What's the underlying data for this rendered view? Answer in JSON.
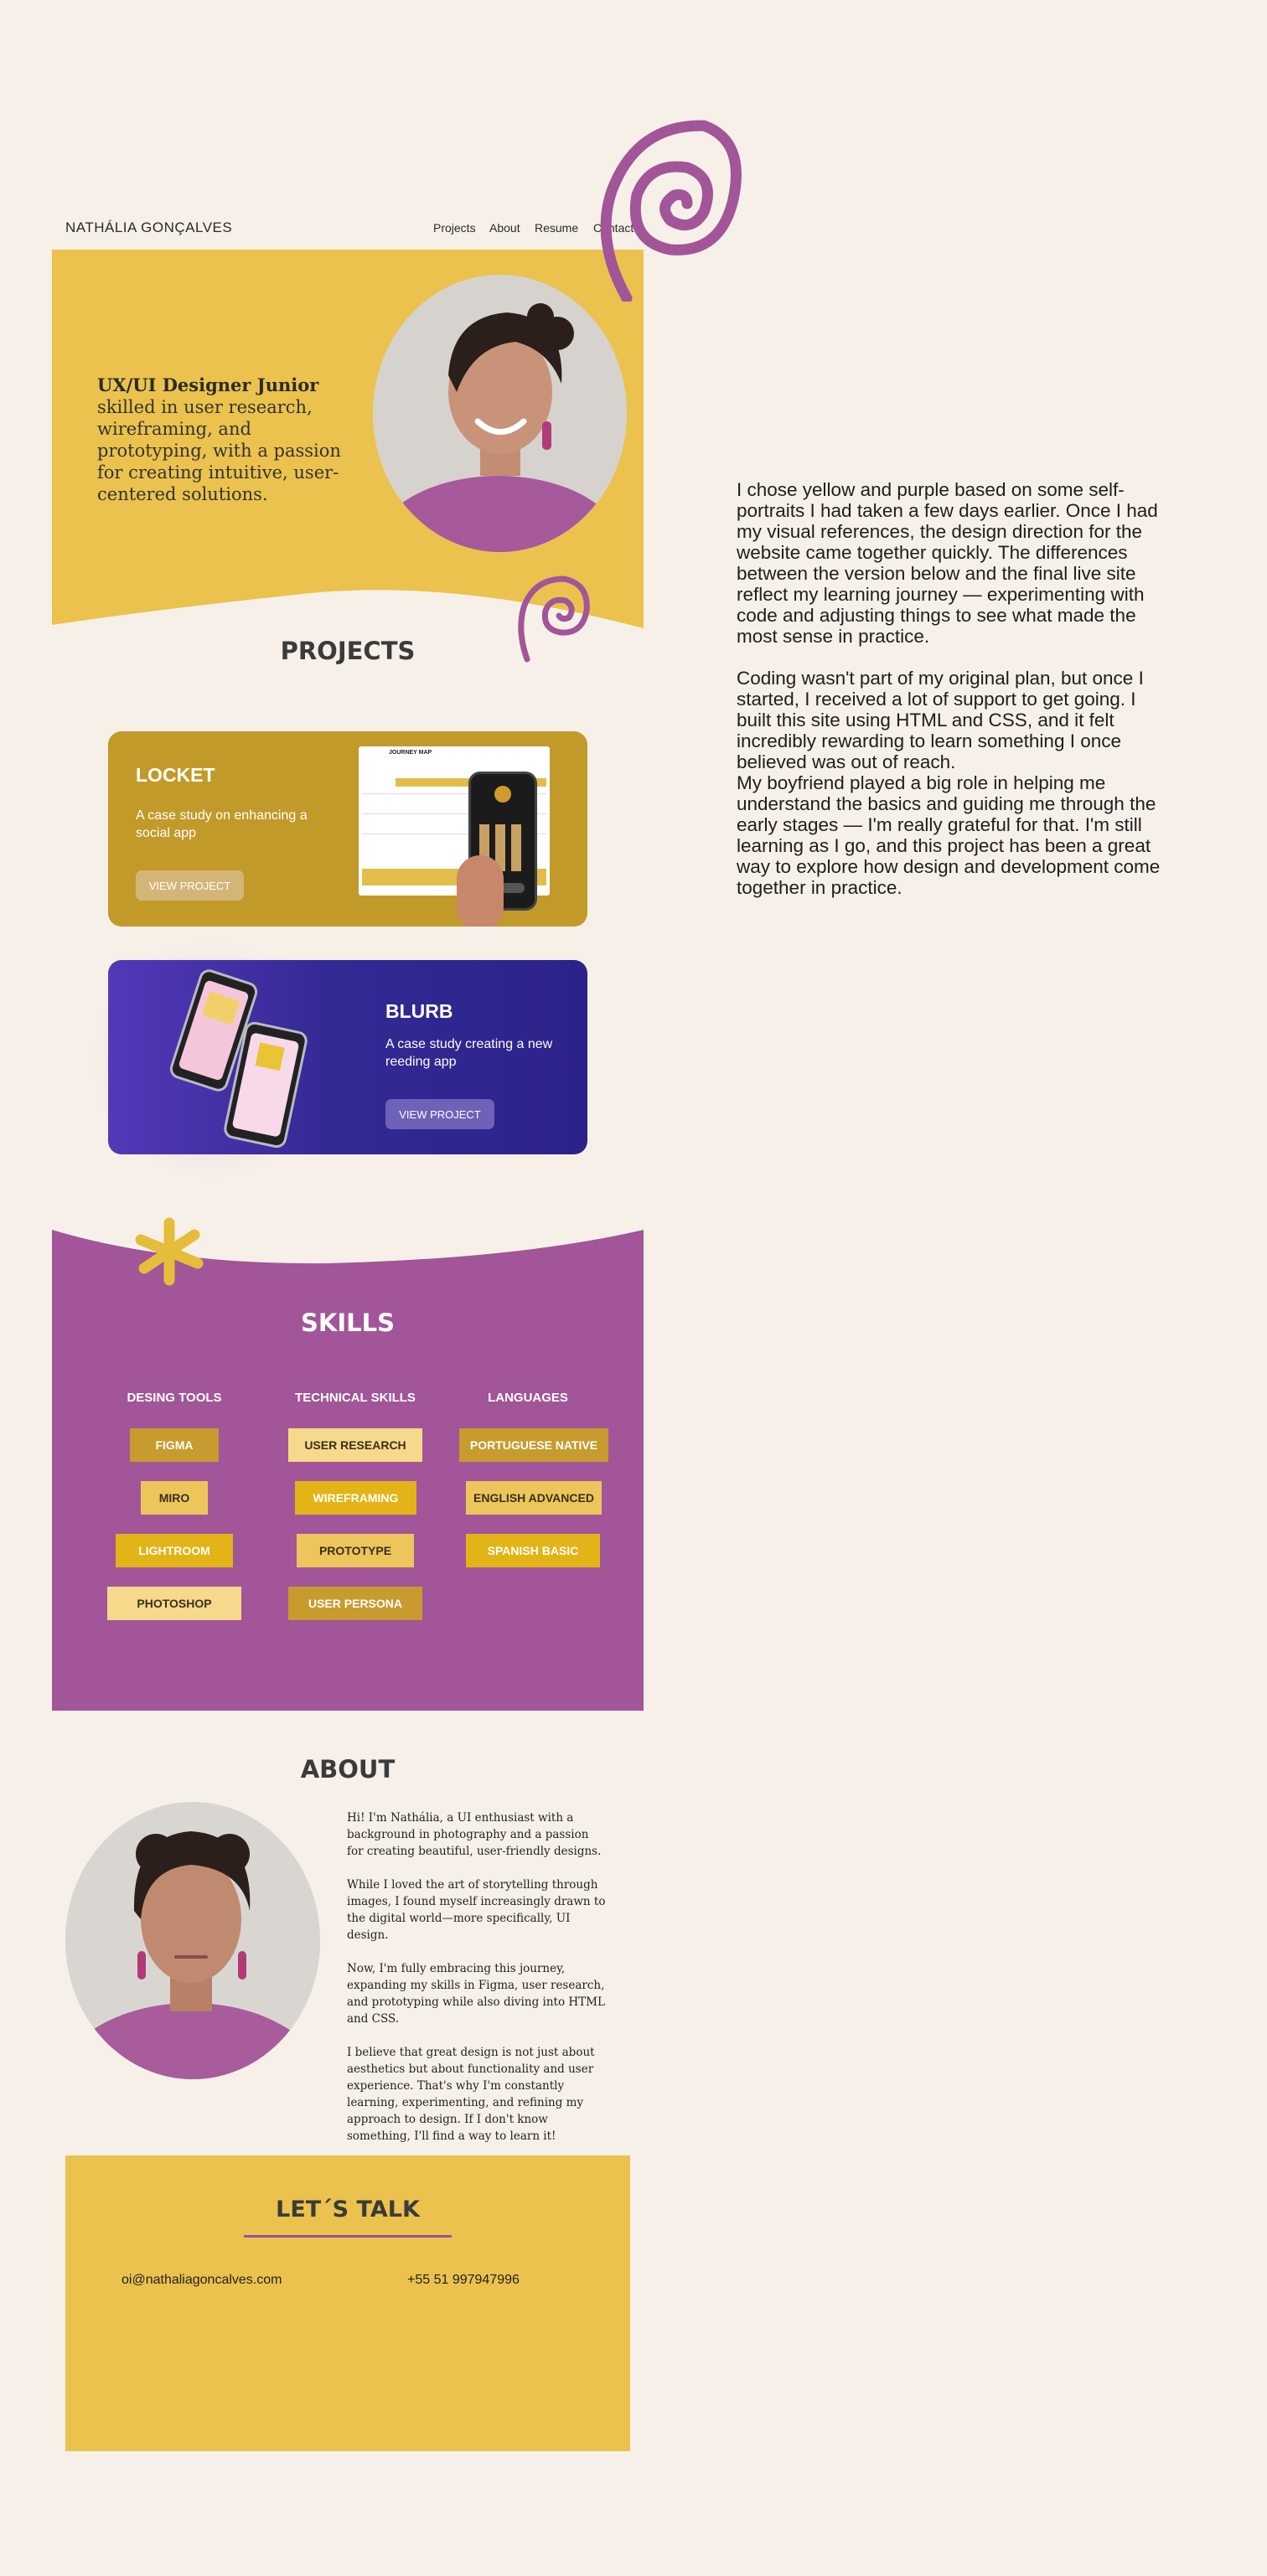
{
  "brand": "NATHÁLIA GONÇALVES",
  "nav": {
    "projects": "Projects",
    "about": "About",
    "resume": "Resume",
    "contact": "Contact"
  },
  "hero": {
    "role": "UX/UI Designer Junior",
    "intro": " skilled in user research, wireframing, and prototyping, with a passion for creating intuitive, user-centered solutions."
  },
  "projects": {
    "title": "PROJECTS",
    "items": [
      {
        "title": "LOCKET",
        "description": "A case study on enhancing a social app",
        "button": "VIEW PROJECT",
        "preview_title": "JOURNEY MAP"
      },
      {
        "title": "BLURB",
        "description": "A case study creating a new reeding app",
        "button": "VIEW PROJECT"
      }
    ]
  },
  "skills": {
    "title": "SKILLS",
    "columns": [
      {
        "heading": "DESING TOOLS",
        "items": [
          "FIGMA",
          "MIRO",
          "LIGHTROOM",
          "PHOTOSHOP"
        ]
      },
      {
        "heading": "TECHNICAL SKILLS",
        "items": [
          "USER RESEARCH",
          "WIREFRAMING",
          "PROTOTYPE",
          "USER PERSONA"
        ]
      },
      {
        "heading": "LANGUAGES",
        "items": [
          "PORTUGUESE NATIVE",
          "ENGLISH ADVANCED",
          "SPANISH BASIC"
        ]
      }
    ]
  },
  "about": {
    "title": "ABOUT",
    "paragraphs": [
      "Hi! I'm Nathália, a UI enthusiast with a background in photography and a passion for creating beautiful, user-friendly designs.",
      "While I loved the art of storytelling through images, I found myself increasingly drawn to the digital world—more specifically, UI design.",
      "Now, I'm fully embracing this journey, expanding my skills in Figma, user research, and prototyping while also diving into HTML and CSS.",
      "I believe that great design is not just about aesthetics but about functionality and user experience. That's why I'm constantly learning, experimenting, and refining my approach to design. If I don't know something, I'll find a way to learn it!"
    ]
  },
  "contact": {
    "title": "LET´S TALK",
    "email": "oi@nathaliagoncalves.com",
    "phone": "+55 51 997947996"
  },
  "reflection": {
    "p1": "I chose yellow and purple based on some self-portraits I had taken a few days earlier. Once I had my visual references, the design direction for the website came together quickly. The differences between the version below and the final live site reflect my learning journey —  experimenting with code and adjusting things to see what made the most sense in practice.",
    "p2": "Coding wasn't part of my original plan, but once I started, I received a lot of support to get going. I built this site using HTML and CSS, and it felt incredibly rewarding to learn something I once believed was out of reach.",
    "p3": "My boyfriend played a big role in helping me understand the basics and guiding me through the early stages —  I'm really grateful for that. I'm still learning as I go, and this project has been a great way to explore how design and development come together in practice."
  },
  "colors": {
    "yellow": "#ebc24d",
    "purple": "#a25598",
    "mustard": "#c29a2a",
    "indigo": "#2c228a",
    "cream": "#f6f0e9"
  }
}
